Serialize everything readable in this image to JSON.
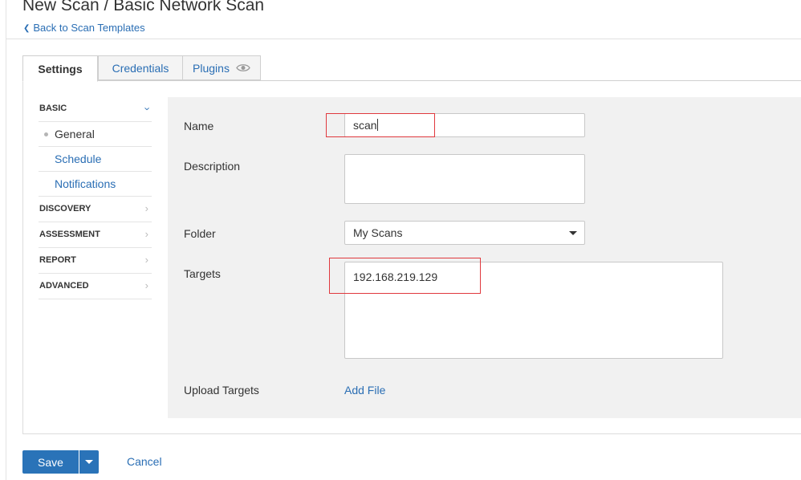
{
  "header": {
    "title": "New Scan / Basic Network Scan",
    "back_link": "Back to Scan Templates"
  },
  "tabs": [
    {
      "label": "Settings",
      "active": true
    },
    {
      "label": "Credentials",
      "active": false
    },
    {
      "label": "Plugins",
      "active": false,
      "icon": "eye-icon"
    }
  ],
  "sidebar": {
    "sections": [
      {
        "label": "BASIC",
        "expanded": true,
        "items": [
          {
            "label": "General",
            "active": true
          },
          {
            "label": "Schedule",
            "active": false
          },
          {
            "label": "Notifications",
            "active": false
          }
        ]
      },
      {
        "label": "DISCOVERY",
        "expanded": false
      },
      {
        "label": "ASSESSMENT",
        "expanded": false
      },
      {
        "label": "REPORT",
        "expanded": false
      },
      {
        "label": "ADVANCED",
        "expanded": false
      }
    ]
  },
  "form": {
    "name_label": "Name",
    "name_value": "scan",
    "description_label": "Description",
    "description_value": "",
    "folder_label": "Folder",
    "folder_value": "My Scans",
    "targets_label": "Targets",
    "targets_value": "192.168.219.129",
    "upload_label": "Upload Targets",
    "add_file": "Add File"
  },
  "actions": {
    "save": "Save",
    "cancel": "Cancel"
  },
  "colors": {
    "accent": "#2a73b8",
    "link": "#2a6eb4",
    "highlight": "#e0393e",
    "form_bg": "#f1f1f1"
  }
}
